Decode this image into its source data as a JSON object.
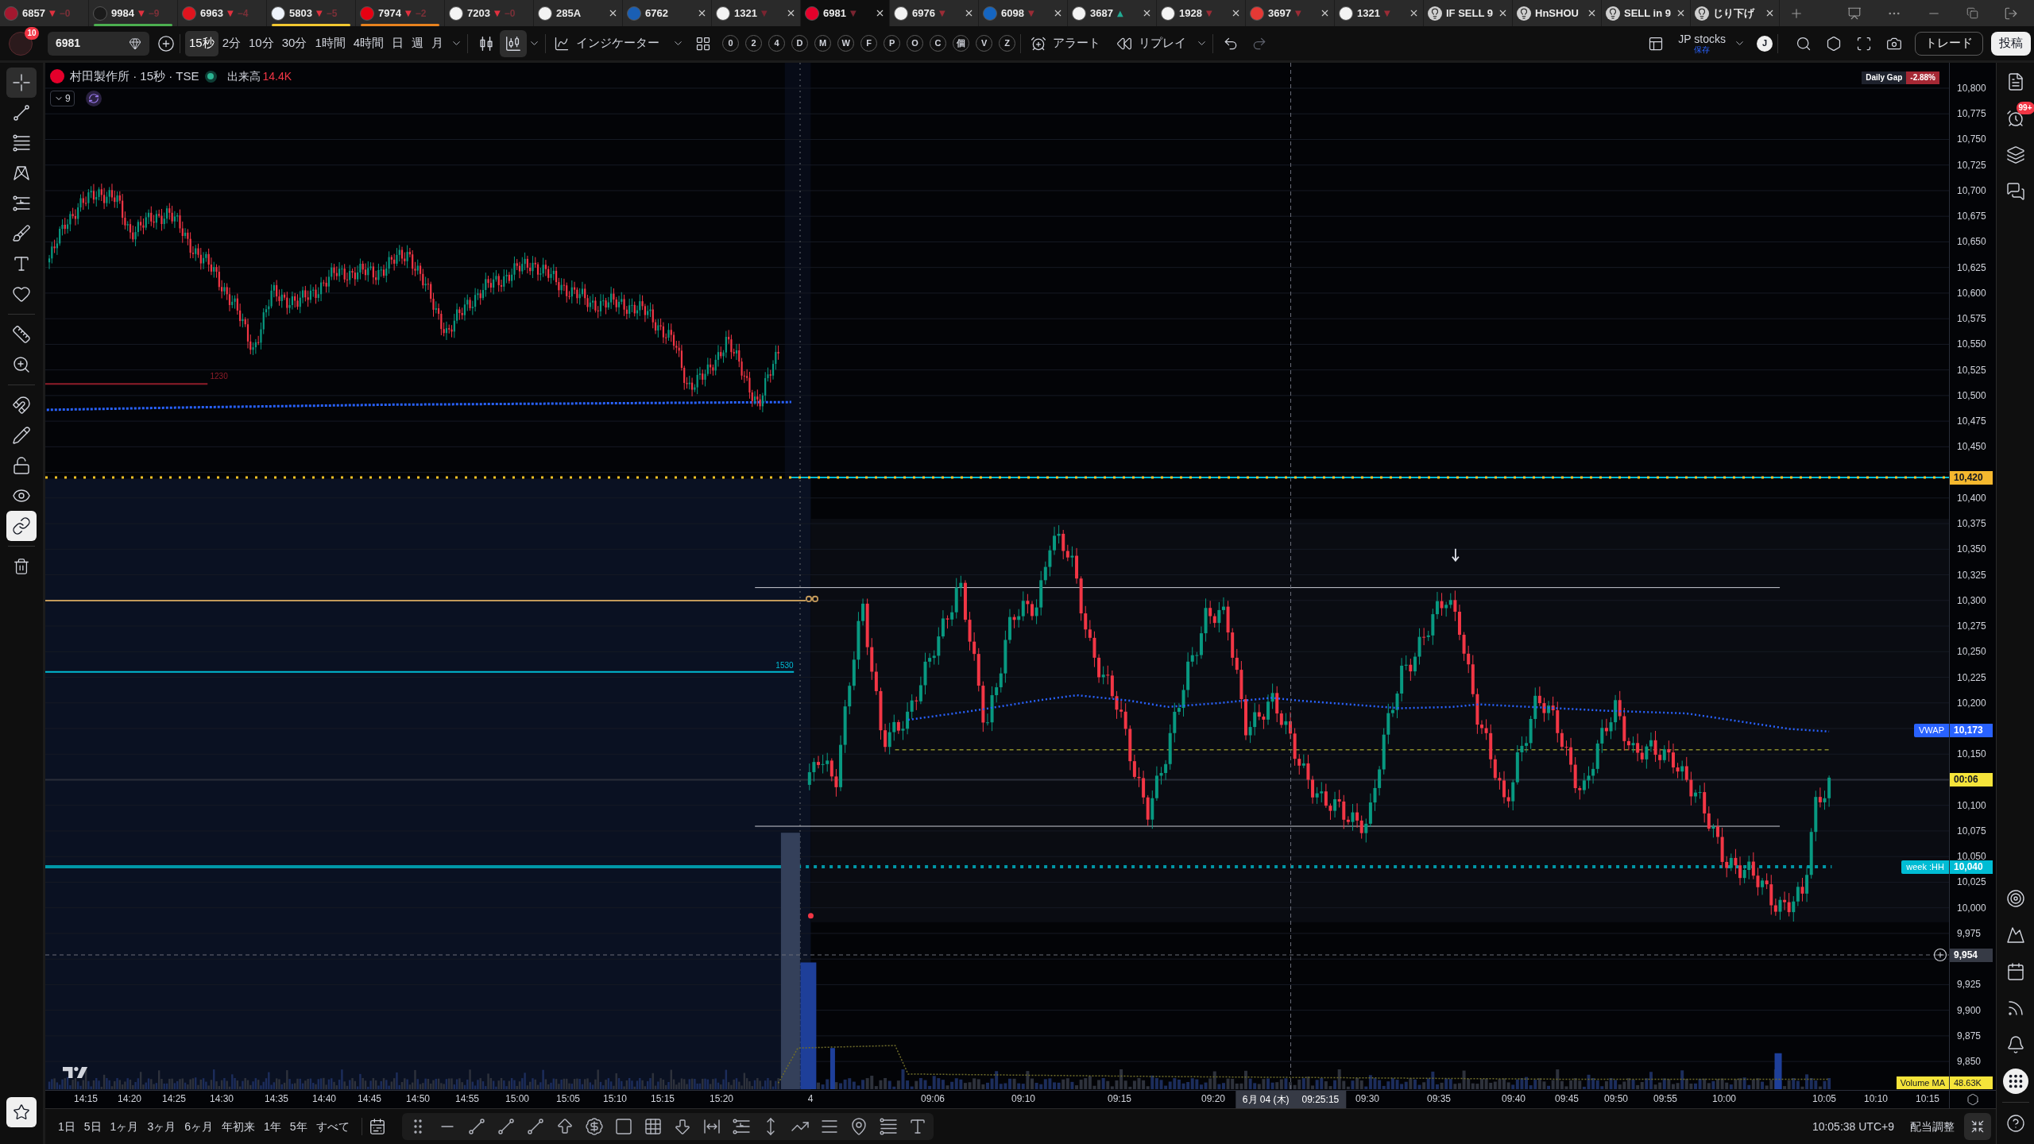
{
  "tabs": [
    {
      "kind": "symbol",
      "label": "6857",
      "logo": {
        "color": "#a3182f"
      },
      "trend": {
        "text": "▼",
        "color": "#e0313f"
      },
      "change": "−0",
      "closable": false,
      "selected": false
    },
    {
      "kind": "symbol",
      "label": "9984",
      "logo": {
        "color": "#1b1b1b"
      },
      "trend": {
        "text": "▼",
        "color": "#e0313f"
      },
      "change": "−9",
      "closable": false,
      "underline": {
        "color": "#4caf50"
      },
      "selected": false
    },
    {
      "kind": "symbol",
      "label": "6963",
      "logo": {
        "color": "#e0141e"
      },
      "trend": {
        "text": "▼",
        "color": "#e0313f"
      },
      "change": "−4",
      "closable": false,
      "selected": false
    },
    {
      "kind": "symbol",
      "label": "5803",
      "logo": {
        "color": "#eef3fb"
      },
      "trend": {
        "text": "▼",
        "color": "#e0313f"
      },
      "change": "−5",
      "closable": false,
      "underline": {
        "color": "#f2c830"
      },
      "selected": false
    },
    {
      "kind": "symbol",
      "label": "7974",
      "logo": {
        "color": "#e60012"
      },
      "trend": {
        "text": "▼",
        "color": "#e0313f"
      },
      "change": "−2",
      "closable": false,
      "underline": {
        "color": "#e8821e"
      },
      "selected": false
    },
    {
      "kind": "symbol",
      "label": "7203",
      "logo": {
        "color": "#f3f3f3"
      },
      "trend": {
        "text": "▼",
        "color": "#e0313f"
      },
      "change": "−0",
      "closable": false,
      "selected": false
    },
    {
      "kind": "symbol",
      "label": "285A",
      "logo": {
        "color": "#f3f3f3"
      },
      "closable": true,
      "selected": false
    },
    {
      "kind": "symbol",
      "label": "6762",
      "logo": {
        "color": "#1a5fb4"
      },
      "closable": true,
      "selected": false
    },
    {
      "kind": "symbol",
      "label": "1321",
      "logo": {
        "color": "#f3f3f3"
      },
      "trend": {
        "text": "▼",
        "color": "#7a2430"
      },
      "closable": true,
      "selected": false
    },
    {
      "kind": "symbol",
      "label": "6981",
      "logo": {
        "color": "#e4002b"
      },
      "trend": {
        "text": "▼",
        "color": "#7a2430"
      },
      "closable": true,
      "selected": true
    },
    {
      "kind": "symbol",
      "label": "6976",
      "logo": {
        "color": "#f3f3f3"
      },
      "trend": {
        "text": "▼",
        "color": "#9b2c36"
      },
      "closable": true,
      "selected": false
    },
    {
      "kind": "symbol",
      "label": "6098",
      "logo": {
        "color": "#1565c0"
      },
      "trend": {
        "text": "▼",
        "color": "#9b2c36"
      },
      "closable": true,
      "selected": false
    },
    {
      "kind": "symbol",
      "label": "3687",
      "logo": {
        "color": "#f3f3f3"
      },
      "trend": {
        "text": "▲",
        "color": "#22ab94"
      },
      "closable": true,
      "selected": false
    },
    {
      "kind": "symbol",
      "label": "1928",
      "logo": {
        "color": "#f3f3f3"
      },
      "trend": {
        "text": "▼",
        "color": "#9b2c36"
      },
      "closable": true,
      "selected": false
    },
    {
      "kind": "symbol",
      "label": "3697",
      "logo": {
        "color": "#e53935"
      },
      "trend": {
        "text": "▼",
        "color": "#9b2c36"
      },
      "closable": true,
      "selected": false
    },
    {
      "kind": "symbol",
      "label": "1321",
      "logo": {
        "color": "#f3f3f3"
      },
      "trend": {
        "text": "▼",
        "color": "#9b2c36"
      },
      "closable": true,
      "selected": false
    },
    {
      "kind": "idea",
      "label": "IF SELL 9",
      "closable": true,
      "selected": false
    },
    {
      "kind": "idea",
      "label": "HnSHOU",
      "closable": true,
      "selected": false
    },
    {
      "kind": "idea",
      "label": "SELL in 9",
      "closable": true,
      "selected": false
    },
    {
      "kind": "idea",
      "label": "じり下げ",
      "closable": true,
      "selected": false
    }
  ],
  "toolbar": {
    "notification_badge": "10",
    "symbol": "6981",
    "intervals": [
      {
        "label": "15秒",
        "selected": true
      },
      {
        "label": "2分",
        "selected": false
      },
      {
        "label": "10分",
        "selected": false
      },
      {
        "label": "30分",
        "selected": false
      },
      {
        "label": "1時間",
        "selected": false
      },
      {
        "label": "4時間",
        "selected": false
      },
      {
        "label": "日",
        "selected": false
      },
      {
        "label": "週",
        "selected": false
      },
      {
        "label": "月",
        "selected": false
      }
    ],
    "chart_styles": [
      {
        "kind": "bars",
        "selected": false
      },
      {
        "kind": "candles",
        "selected": true
      }
    ],
    "indicators_label": "インジケーター",
    "quick_buttons": [
      "0",
      "2",
      "4",
      "D",
      "M",
      "W",
      "F",
      "P",
      "O",
      "C",
      "個",
      "V",
      "Z"
    ],
    "alert_label": "アラート",
    "replay_label": "リプレイ",
    "layout_name": "JP stocks",
    "layout_status": "保存",
    "user_initial": "J",
    "trade_label": "トレード",
    "publish_label": "投稿"
  },
  "left_toolbar": {
    "tools": [
      {
        "kind": "crosshair",
        "selected": true
      },
      {
        "kind": "trend_line",
        "selected": false
      },
      {
        "kind": "fib",
        "selected": false
      },
      {
        "kind": "pattern",
        "selected": false
      },
      {
        "kind": "projection",
        "selected": false
      },
      {
        "kind": "brush",
        "selected": false
      },
      {
        "kind": "text",
        "selected": false
      },
      {
        "kind": "favorite",
        "selected": false
      }
    ],
    "measure": [
      {
        "kind": "ruler",
        "selected": false
      },
      {
        "kind": "zoom",
        "selected": false
      }
    ],
    "toggles": [
      {
        "kind": "magnet",
        "on": false
      },
      {
        "kind": "lock_drawing",
        "on": false
      },
      {
        "kind": "lock",
        "on": false
      },
      {
        "kind": "visibility",
        "on": false
      },
      {
        "kind": "sync",
        "on": true
      }
    ],
    "favorites_on": true
  },
  "chart": {
    "legend": {
      "title": "村田製作所 · 15秒 · TSE",
      "market_open": true,
      "volume_label": "出来高",
      "volume_value": "14.4K",
      "collapsed_count": "9"
    },
    "daily_gap": {
      "label": "Daily Gap",
      "value": "-2.88%"
    },
    "line_labels": [
      {
        "text": "1230",
        "color": "#8f1d2a"
      },
      {
        "text": "1530",
        "color": "#00bcd4"
      }
    ],
    "volume_ma": {
      "label": "Volume MA",
      "value": "48.63K"
    }
  },
  "price_axis": {
    "labels": [
      "10,800",
      "10,775",
      "10,750",
      "10,725",
      "10,700",
      "10,675",
      "10,650",
      "10,625",
      "10,600",
      "10,575",
      "10,550",
      "10,525",
      "10,500",
      "10,475",
      "10,450",
      "10,400",
      "10,375",
      "10,350",
      "10,325",
      "10,300",
      "10,275",
      "10,250",
      "10,225",
      "10,200",
      "10,150",
      "10,100",
      "10,075",
      "10,050",
      "10,025",
      "10,000",
      "9,975",
      "9,925",
      "9,900",
      "9,875",
      "9,850"
    ],
    "tags": [
      {
        "kind": "line",
        "value": "10,420",
        "color": "#f5b82e"
      },
      {
        "kind": "indicator",
        "name": "VWAP",
        "value": "10,173",
        "color": "#2962ff"
      },
      {
        "kind": "countdown",
        "value": "00:06",
        "color": "#f5e43a"
      },
      {
        "kind": "indicator",
        "name": "week :HH",
        "value": "10,040",
        "color": "#00bcd4"
      },
      {
        "kind": "crosshair",
        "value": "9,954"
      }
    ]
  },
  "time_axis": {
    "labels": [
      "14:15",
      "14:20",
      "14:25",
      "14:30",
      "14:35",
      "14:40",
      "14:45",
      "14:50",
      "14:55",
      "15:00",
      "15:05",
      "15:10",
      "15:15",
      "15:20",
      "4",
      "09:06",
      "09:10",
      "09:15",
      "09:20",
      "09:30",
      "09:35",
      "09:40",
      "09:45",
      "09:50",
      "09:55",
      "10:00",
      "10:05",
      "10:10",
      "10:15"
    ],
    "crosshair_date": "6月 04 (木)",
    "crosshair_time": "09:25:15"
  },
  "bottom_bar": {
    "ranges": [
      "1日",
      "5日",
      "1ヶ月",
      "3ヶ月",
      "6ヶ月",
      "年初来",
      "1年",
      "5年",
      "すべて"
    ],
    "clock": "10:05:38 UTC+9",
    "adjustment": "配当調整"
  },
  "right_sidebar": {
    "alerts_badge": "99+"
  }
}
